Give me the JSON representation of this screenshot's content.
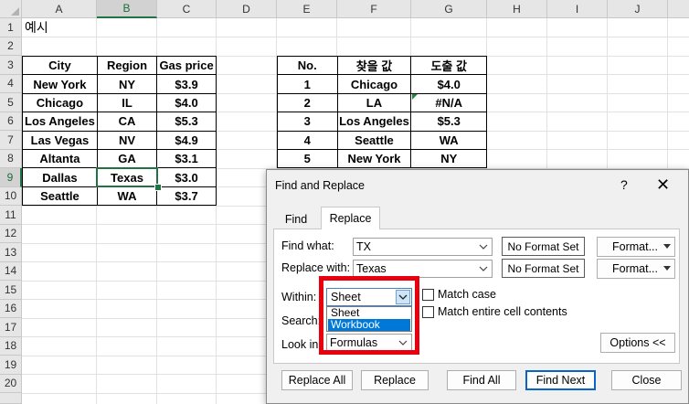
{
  "columns": [
    "A",
    "B",
    "C",
    "D",
    "E",
    "F",
    "G",
    "H",
    "I",
    "J"
  ],
  "rows": [
    "1",
    "2",
    "3",
    "4",
    "5",
    "6",
    "7",
    "8",
    "9",
    "10",
    "11",
    "12",
    "13",
    "14",
    "15",
    "16",
    "17",
    "18",
    "19",
    "20"
  ],
  "cell_a1": "예시",
  "table1": {
    "headers": [
      "City",
      "Region",
      "Gas price"
    ],
    "rows": [
      [
        "New York",
        "NY",
        "$3.9"
      ],
      [
        "Chicago",
        "IL",
        "$4.0"
      ],
      [
        "Los Angeles",
        "CA",
        "$5.3"
      ],
      [
        "Las Vegas",
        "NV",
        "$4.9"
      ],
      [
        "Altanta",
        "GA",
        "$3.1"
      ],
      [
        "Dallas",
        "Texas",
        "$3.0"
      ],
      [
        "Seattle",
        "WA",
        "$3.7"
      ]
    ]
  },
  "table2": {
    "headers": [
      "No.",
      "찾을 값",
      "도출 값"
    ],
    "rows": [
      [
        "1",
        "Chicago",
        "$4.0"
      ],
      [
        "2",
        "LA",
        "#N/A"
      ],
      [
        "3",
        "Los Angeles",
        "$5.3"
      ],
      [
        "4",
        "Seattle",
        "WA"
      ],
      [
        "5",
        "New York",
        "NY"
      ]
    ]
  },
  "dialog": {
    "title": "Find and Replace",
    "help": "?",
    "close": "✕",
    "tabs": [
      "Find",
      "Replace"
    ],
    "find_what_label": "Find what:",
    "find_what_value": "TX",
    "replace_with_label": "Replace with:",
    "replace_with_value": "Texas",
    "no_format_set": "No Format Set",
    "format_button": "Format...",
    "within_label": "Within:",
    "within_value": "Sheet",
    "within_options": [
      "Sheet",
      "Workbook"
    ],
    "search_label": "Search:",
    "lookin_label": "Look in:",
    "lookin_value": "Formulas",
    "match_case": "Match case",
    "match_entire": "Match entire cell contents",
    "options_button": "Options <<",
    "buttons": {
      "replace_all": "Replace All",
      "replace": "Replace",
      "find_all": "Find All",
      "find_next": "Find Next",
      "close": "Close"
    }
  },
  "colors": {
    "selection_green": "#217346",
    "highlight_red": "#e8000f",
    "list_highlight": "#0078d7"
  }
}
